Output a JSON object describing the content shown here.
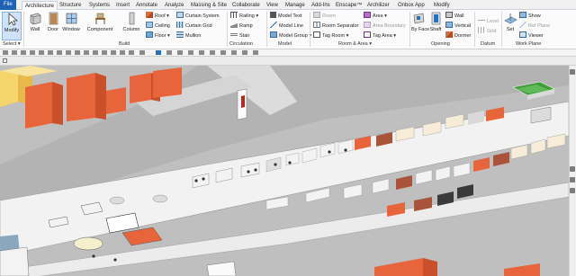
{
  "tabs": [
    "File",
    "Architecture",
    "Structure",
    "Systems",
    "Insert",
    "Annotate",
    "Analyze",
    "Massing & Site",
    "Collaborate",
    "View",
    "Manage",
    "Add-Ins",
    "Enscape™",
    "Archilizer",
    "Onbox App",
    "Modify"
  ],
  "select": {
    "modify_label": "Modify",
    "panel_label": "Select ▾"
  },
  "build": {
    "panel_label": "Build",
    "wall": "Wall",
    "door": "Door",
    "window": "Window",
    "component": "Component",
    "column": "Column",
    "roof": "Roof ▾",
    "ceiling": "Ceiling",
    "floor": "Floor ▾",
    "curtain_system": "Curtain System",
    "curtain_grid": "Curtain Grid",
    "mullion": "Mullion"
  },
  "circulation": {
    "panel_label": "Circulation",
    "railing": "Railing ▾",
    "ramp": "Ramp",
    "stair": "Stair"
  },
  "model": {
    "panel_label": "Model",
    "text": "Model Text",
    "line": "Model Line",
    "group": "Model Group ▾"
  },
  "room_area": {
    "panel_label": "Room & Area ▾",
    "room": "Room",
    "separator": "Room Separator",
    "tag_room": "Tag Room ▾",
    "area": "Area ▾",
    "area_boundary": "Area Boundary",
    "tag_area": "Tag Area ▾"
  },
  "opening": {
    "panel_label": "Opening",
    "by_face": "By Face",
    "shaft": "Shaft",
    "wall": "Wall",
    "vertical": "Vertical",
    "dormer": "Dormer"
  },
  "datum": {
    "panel_label": "Datum",
    "level": "Level",
    "grid": "Grid"
  },
  "work_plane": {
    "panel_label": "Work Plane",
    "set": "Set",
    "show": "Show",
    "ref_plane": "Ref Plane",
    "viewer": "Viewer"
  },
  "colors": {
    "ribbon_blue": "#1d62b5",
    "building_orange": "#e8643a",
    "floor_gray": "#bdbdbd",
    "road": "#efefef",
    "highlight_yellow": "#f5d56b"
  }
}
